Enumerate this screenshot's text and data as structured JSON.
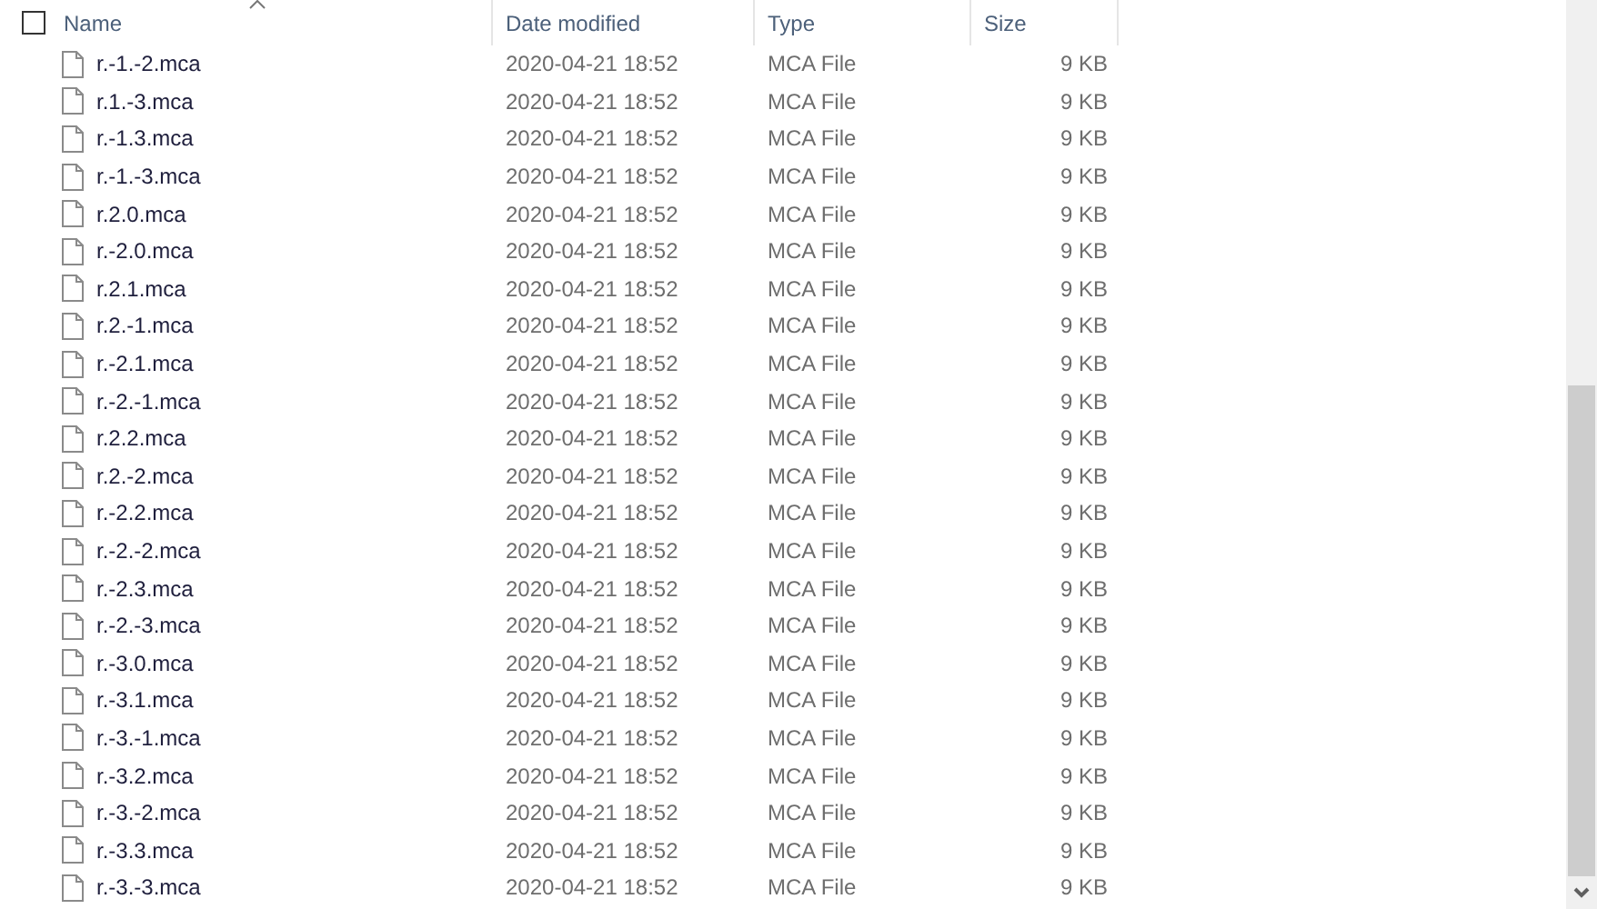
{
  "header": {
    "select_all": {
      "checked": false
    },
    "columns": [
      {
        "label": "Name",
        "sorted": true
      },
      {
        "label": "Date modified",
        "sorted": false
      },
      {
        "label": "Type",
        "sorted": false
      },
      {
        "label": "Size",
        "sorted": false
      }
    ]
  },
  "files": [
    {
      "name": "r.-1.-2.mca",
      "date": "2020-04-21 18:52",
      "type": "MCA File",
      "size": "9 KB"
    },
    {
      "name": "r.1.-3.mca",
      "date": "2020-04-21 18:52",
      "type": "MCA File",
      "size": "9 KB"
    },
    {
      "name": "r.-1.3.mca",
      "date": "2020-04-21 18:52",
      "type": "MCA File",
      "size": "9 KB"
    },
    {
      "name": "r.-1.-3.mca",
      "date": "2020-04-21 18:52",
      "type": "MCA File",
      "size": "9 KB"
    },
    {
      "name": "r.2.0.mca",
      "date": "2020-04-21 18:52",
      "type": "MCA File",
      "size": "9 KB"
    },
    {
      "name": "r.-2.0.mca",
      "date": "2020-04-21 18:52",
      "type": "MCA File",
      "size": "9 KB"
    },
    {
      "name": "r.2.1.mca",
      "date": "2020-04-21 18:52",
      "type": "MCA File",
      "size": "9 KB"
    },
    {
      "name": "r.2.-1.mca",
      "date": "2020-04-21 18:52",
      "type": "MCA File",
      "size": "9 KB"
    },
    {
      "name": "r.-2.1.mca",
      "date": "2020-04-21 18:52",
      "type": "MCA File",
      "size": "9 KB"
    },
    {
      "name": "r.-2.-1.mca",
      "date": "2020-04-21 18:52",
      "type": "MCA File",
      "size": "9 KB"
    },
    {
      "name": "r.2.2.mca",
      "date": "2020-04-21 18:52",
      "type": "MCA File",
      "size": "9 KB"
    },
    {
      "name": "r.2.-2.mca",
      "date": "2020-04-21 18:52",
      "type": "MCA File",
      "size": "9 KB"
    },
    {
      "name": "r.-2.2.mca",
      "date": "2020-04-21 18:52",
      "type": "MCA File",
      "size": "9 KB"
    },
    {
      "name": "r.-2.-2.mca",
      "date": "2020-04-21 18:52",
      "type": "MCA File",
      "size": "9 KB"
    },
    {
      "name": "r.-2.3.mca",
      "date": "2020-04-21 18:52",
      "type": "MCA File",
      "size": "9 KB"
    },
    {
      "name": "r.-2.-3.mca",
      "date": "2020-04-21 18:52",
      "type": "MCA File",
      "size": "9 KB"
    },
    {
      "name": "r.-3.0.mca",
      "date": "2020-04-21 18:52",
      "type": "MCA File",
      "size": "9 KB"
    },
    {
      "name": "r.-3.1.mca",
      "date": "2020-04-21 18:52",
      "type": "MCA File",
      "size": "9 KB"
    },
    {
      "name": "r.-3.-1.mca",
      "date": "2020-04-21 18:52",
      "type": "MCA File",
      "size": "9 KB"
    },
    {
      "name": "r.-3.2.mca",
      "date": "2020-04-21 18:52",
      "type": "MCA File",
      "size": "9 KB"
    },
    {
      "name": "r.-3.-2.mca",
      "date": "2020-04-21 18:52",
      "type": "MCA File",
      "size": "9 KB"
    },
    {
      "name": "r.-3.3.mca",
      "date": "2020-04-21 18:52",
      "type": "MCA File",
      "size": "9 KB"
    },
    {
      "name": "r.-3.-3.mca",
      "date": "2020-04-21 18:52",
      "type": "MCA File",
      "size": "9 KB"
    }
  ]
}
